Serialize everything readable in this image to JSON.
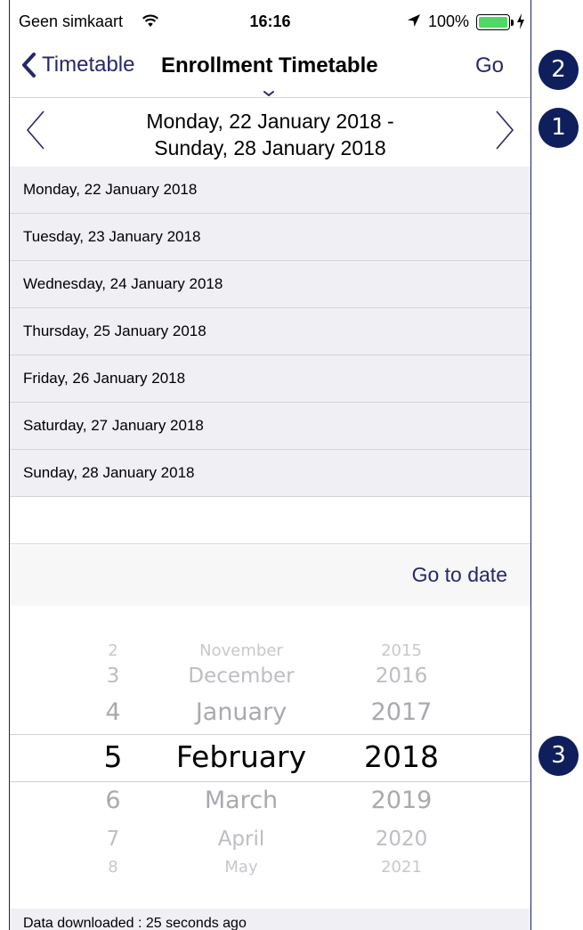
{
  "status_bar": {
    "carrier": "Geen simkaart",
    "time": "16:16",
    "battery_percent": "100%",
    "battery_level": 1.0,
    "icons": [
      "wifi-icon",
      "location-arrow-icon",
      "battery-icon",
      "charging-bolt-icon"
    ]
  },
  "nav": {
    "back_label": "Timetable",
    "title": "Enrollment Timetable",
    "go_label": "Go",
    "icons": [
      "chevron-left-icon",
      "chevron-down-small-icon"
    ]
  },
  "week": {
    "range_line1": "Monday, 22 January 2018 -",
    "range_line2": "Sunday, 28 January 2018",
    "icons": [
      "prev-week-icon",
      "next-week-icon"
    ]
  },
  "days": [
    "Monday, 22 January 2018",
    "Tuesday, 23 January 2018",
    "Wednesday, 24 January 2018",
    "Thursday, 25 January 2018",
    "Friday, 26 January 2018",
    "Saturday, 27 January 2018",
    "Sunday, 28 January 2018"
  ],
  "goto": {
    "label": "Go to date"
  },
  "picker": {
    "day_items": [
      "2",
      "3",
      "4",
      "5",
      "6",
      "7",
      "8"
    ],
    "month_items": [
      "November",
      "December",
      "January",
      "February",
      "March",
      "April",
      "May"
    ],
    "year_items": [
      "2015",
      "2016",
      "2017",
      "2018",
      "2019",
      "2020",
      "2021"
    ],
    "selected": {
      "day": "5",
      "month": "February",
      "year": "2018"
    }
  },
  "footer": {
    "text": "Data downloaded : 25 seconds ago"
  },
  "callouts": [
    "2",
    "1",
    "3"
  ],
  "colors": {
    "accent": "#27286a",
    "badge": "#0f1f5c",
    "row_bg": "#efeff4",
    "battery": "#4cd964"
  }
}
